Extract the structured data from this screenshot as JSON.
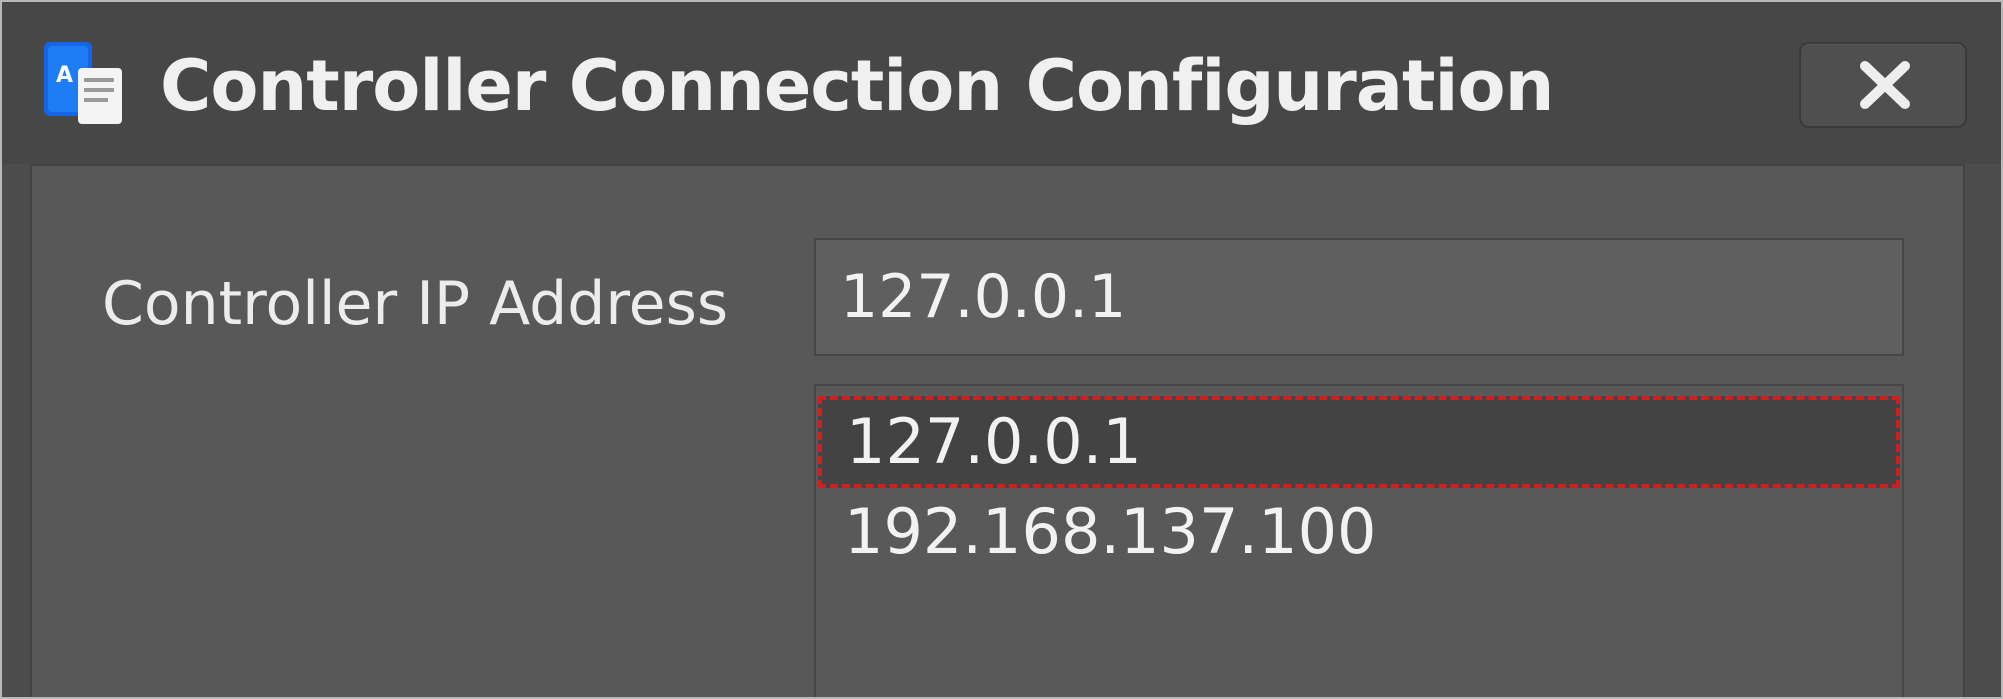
{
  "window": {
    "title": "Controller Connection Configuration",
    "icon": "app-icon",
    "close_icon": "close-icon"
  },
  "form": {
    "ip_label": "Controller IP Address",
    "ip_value": "127.0.0.1"
  },
  "dropdown": {
    "items": [
      {
        "label": "127.0.0.1",
        "selected": true
      },
      {
        "label": "192.168.137.100",
        "selected": false
      }
    ]
  },
  "colors": {
    "selection_outline": "#d01f1f",
    "app_icon_blue": "#1565e8"
  }
}
